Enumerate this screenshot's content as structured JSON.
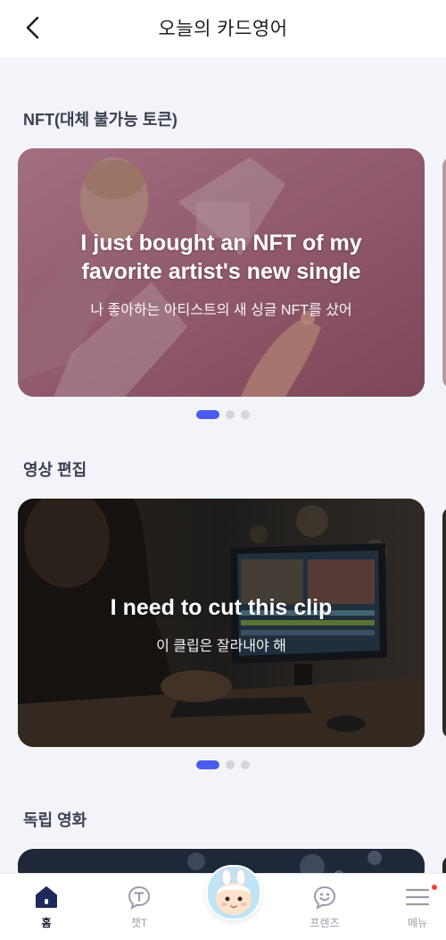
{
  "header": {
    "title": "오늘의 카드영어"
  },
  "sections": [
    {
      "title": "NFT(대체 불가능 토큰)",
      "card": {
        "english": [
          "I just bought an NFT of my",
          "favorite artist's new single"
        ],
        "korean": "나 좋아하는 아티스트의 새 싱글 NFT를 샀어"
      },
      "active_dot": 1,
      "dot_count": 3
    },
    {
      "title": "영상 편집",
      "card": {
        "english": [
          "I need to cut this clip"
        ],
        "korean": "이 클립은 잘라내야 해"
      },
      "active_dot": 1,
      "dot_count": 3
    },
    {
      "title": "독립 영화"
    }
  ],
  "tabbar": {
    "items": [
      {
        "label": "홈",
        "icon": "home-icon",
        "active": true
      },
      {
        "label": "챗T",
        "icon": "chat-t-icon",
        "active": false
      },
      {
        "label": "",
        "icon": "character-avatar",
        "active": false
      },
      {
        "label": "프렌즈",
        "icon": "smile-chat-icon",
        "active": false
      },
      {
        "label": "메뉴",
        "icon": "hamburger-menu-icon",
        "active": false
      }
    ]
  },
  "colors": {
    "accent": "#4a5cf0",
    "section_title": "#3b3f52",
    "notification_dot": "#ff3b3b"
  }
}
